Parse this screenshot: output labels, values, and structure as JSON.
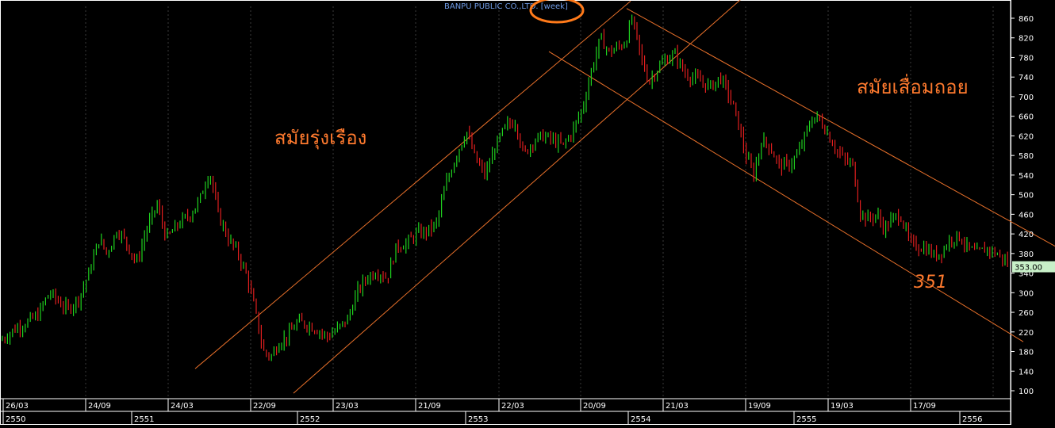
{
  "chart_data": {
    "type": "candlestick",
    "title": "BANPU PUBLIC CO.,LTD. [week]",
    "ylim": [
      80,
      880
    ],
    "y_ticks": [
      100,
      140,
      180,
      220,
      260,
      300,
      340,
      380,
      420,
      460,
      500,
      540,
      580,
      620,
      660,
      700,
      740,
      780,
      820,
      860
    ],
    "last_price": "353.00",
    "x_labels_row1": [
      "26/03",
      "24/09",
      "24/03",
      "22/09",
      "23/03",
      "21/09",
      "22/03",
      "20/09",
      "21/03",
      "19/09",
      "19/03",
      "17/09"
    ],
    "x_labels_row2": [
      "2550",
      "2551",
      "2552",
      "2553",
      "2554",
      "2555",
      "2556"
    ],
    "annotations": {
      "boom": "สมัยรุ่งเรือง",
      "decline": "สมัยเสื่อมถอย",
      "target": "351"
    },
    "price_path": [
      [
        0,
        200
      ],
      [
        10,
        215
      ],
      [
        22,
        230
      ],
      [
        35,
        240
      ],
      [
        48,
        255
      ],
      [
        62,
        300
      ],
      [
        72,
        285
      ],
      [
        85,
        265
      ],
      [
        100,
        290
      ],
      [
        112,
        340
      ],
      [
        125,
        410
      ],
      [
        135,
        380
      ],
      [
        148,
        430
      ],
      [
        160,
        400
      ],
      [
        172,
        360
      ],
      [
        185,
        430
      ],
      [
        198,
        480
      ],
      [
        210,
        410
      ],
      [
        225,
        440
      ],
      [
        240,
        460
      ],
      [
        252,
        490
      ],
      [
        264,
        550
      ],
      [
        275,
        460
      ],
      [
        288,
        410
      ],
      [
        300,
        380
      ],
      [
        312,
        330
      ],
      [
        322,
        260
      ],
      [
        332,
        180
      ],
      [
        342,
        170
      ],
      [
        352,
        200
      ],
      [
        362,
        210
      ],
      [
        375,
        240
      ],
      [
        388,
        235
      ],
      [
        400,
        225
      ],
      [
        412,
        210
      ],
      [
        425,
        225
      ],
      [
        438,
        245
      ],
      [
        450,
        300
      ],
      [
        462,
        330
      ],
      [
        475,
        345
      ],
      [
        488,
        330
      ],
      [
        500,
        395
      ],
      [
        512,
        400
      ],
      [
        525,
        420
      ],
      [
        538,
        425
      ],
      [
        550,
        440
      ],
      [
        562,
        520
      ],
      [
        575,
        580
      ],
      [
        588,
        630
      ],
      [
        600,
        570
      ],
      [
        612,
        540
      ],
      [
        625,
        600
      ],
      [
        638,
        640
      ],
      [
        650,
        650
      ],
      [
        660,
        580
      ],
      [
        672,
        610
      ],
      [
        685,
        620
      ],
      [
        698,
        610
      ],
      [
        710,
        600
      ],
      [
        722,
        630
      ],
      [
        735,
        680
      ],
      [
        745,
        750
      ],
      [
        757,
        820
      ],
      [
        768,
        790
      ],
      [
        778,
        800
      ],
      [
        788,
        810
      ],
      [
        797,
        860
      ],
      [
        808,
        780
      ],
      [
        818,
        730
      ],
      [
        830,
        760
      ],
      [
        842,
        780
      ],
      [
        852,
        785
      ],
      [
        862,
        750
      ],
      [
        872,
        740
      ],
      [
        884,
        730
      ],
      [
        896,
        720
      ],
      [
        908,
        740
      ],
      [
        920,
        700
      ],
      [
        930,
        650
      ],
      [
        940,
        580
      ],
      [
        950,
        540
      ],
      [
        960,
        610
      ],
      [
        970,
        600
      ],
      [
        982,
        560
      ],
      [
        994,
        560
      ],
      [
        1005,
        580
      ],
      [
        1015,
        620
      ],
      [
        1025,
        660
      ],
      [
        1035,
        650
      ],
      [
        1045,
        620
      ],
      [
        1055,
        590
      ],
      [
        1065,
        570
      ],
      [
        1075,
        560
      ],
      [
        1085,
        460
      ],
      [
        1095,
        450
      ],
      [
        1105,
        460
      ],
      [
        1115,
        430
      ],
      [
        1125,
        450
      ],
      [
        1135,
        460
      ],
      [
        1147,
        400
      ],
      [
        1157,
        395
      ],
      [
        1168,
        390
      ],
      [
        1178,
        375
      ],
      [
        1188,
        385
      ],
      [
        1198,
        410
      ],
      [
        1210,
        415
      ],
      [
        1220,
        390
      ],
      [
        1232,
        380
      ],
      [
        1244,
        390
      ],
      [
        1256,
        380
      ],
      [
        1268,
        365
      ],
      [
        1274,
        353
      ]
    ]
  }
}
